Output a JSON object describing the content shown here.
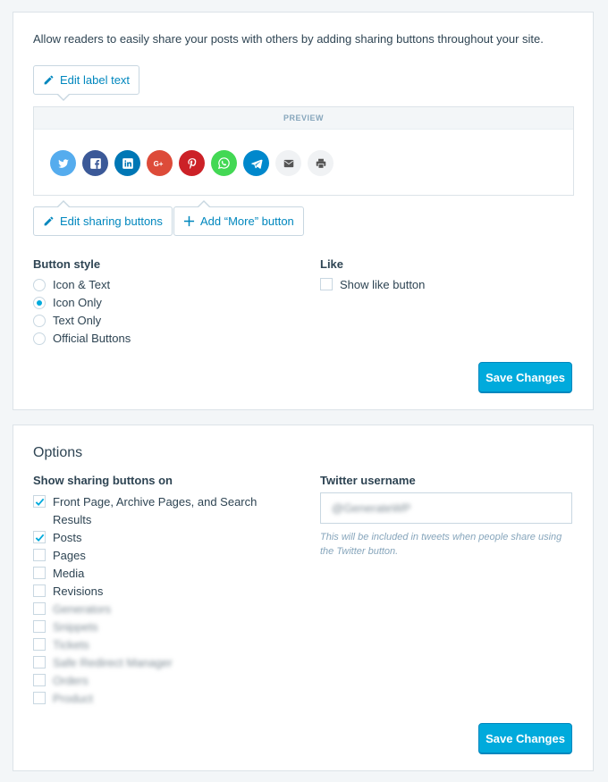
{
  "sharing": {
    "intro": "Allow readers to easily share your posts with others by adding sharing buttons throughout your site.",
    "edit_label_text": "Edit label text",
    "preview_heading": "PREVIEW",
    "share_icons": [
      {
        "name": "twitter-icon",
        "color": "#55acee",
        "glyph": "t"
      },
      {
        "name": "facebook-icon",
        "color": "#3b5998",
        "glyph": "f"
      },
      {
        "name": "linkedin-icon",
        "color": "#0077b5",
        "glyph": "in"
      },
      {
        "name": "google-plus-icon",
        "color": "#dd4b39",
        "glyph": "G+"
      },
      {
        "name": "pinterest-icon",
        "color": "#cc2127",
        "glyph": "P"
      },
      {
        "name": "whatsapp-icon",
        "color": "#43d854",
        "glyph": "w"
      },
      {
        "name": "telegram-icon",
        "color": "#0088cc",
        "glyph": "tg"
      },
      {
        "name": "email-icon",
        "color": "#f0f2f4",
        "glyph": "mail"
      },
      {
        "name": "print-icon",
        "color": "#f0f2f4",
        "glyph": "print"
      }
    ],
    "edit_sharing_buttons": "Edit sharing buttons",
    "add_more_button": "Add “More” button",
    "button_style_label": "Button style",
    "button_styles": [
      {
        "label": "Icon & Text",
        "selected": false
      },
      {
        "label": "Icon Only",
        "selected": true
      },
      {
        "label": "Text Only",
        "selected": false
      },
      {
        "label": "Official Buttons",
        "selected": false
      }
    ],
    "like_label": "Like",
    "show_like_button": "Show like button",
    "save_label": "Save Changes"
  },
  "options": {
    "title": "Options",
    "show_on_label": "Show sharing buttons on",
    "show_on_items": [
      {
        "label": "Front Page, Archive Pages, and Search",
        "checked": true
      },
      {
        "label": "Results",
        "checked": null
      },
      {
        "label": "Posts",
        "checked": true
      },
      {
        "label": "Pages",
        "checked": false
      },
      {
        "label": "Media",
        "checked": false
      },
      {
        "label": "Revisions",
        "checked": false
      },
      {
        "label": "Generators",
        "checked": false,
        "blurred": true
      },
      {
        "label": "Snippets",
        "checked": false,
        "blurred": true
      },
      {
        "label": "Tickets",
        "checked": false,
        "blurred": true
      },
      {
        "label": "Safe Redirect Manager",
        "checked": false,
        "blurred": true
      },
      {
        "label": "Orders",
        "checked": false,
        "blurred": true
      },
      {
        "label": "Product",
        "checked": false,
        "blurred": true
      }
    ],
    "twitter_label": "Twitter username",
    "twitter_value": "@GenerateWP",
    "twitter_hint": "This will be included in tweets when people share using the Twitter button.",
    "save_label": "Save Changes"
  }
}
